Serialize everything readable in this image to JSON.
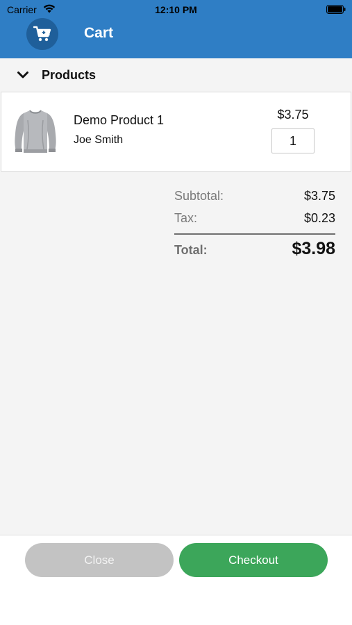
{
  "status_bar": {
    "carrier": "Carrier",
    "time": "12:10 PM",
    "icons": [
      "wifi-icon",
      "battery-icon"
    ]
  },
  "nav": {
    "title": "Cart",
    "icon": "cart-icon",
    "color": "#2f7ec5"
  },
  "products_section": {
    "title": "Products",
    "icon": "chevron-down-icon",
    "items": [
      {
        "name": "Demo Product 1",
        "owner": "Joe Smith",
        "price": "$3.75",
        "quantity": "1",
        "image": "sweatshirt-image"
      }
    ]
  },
  "totals": {
    "subtotal_label": "Subtotal:",
    "subtotal_value": "$3.75",
    "tax_label": "Tax:",
    "tax_value": "$0.23",
    "total_label": "Total:",
    "total_value": "$3.98"
  },
  "footer": {
    "close_label": "Close",
    "checkout_label": "Checkout",
    "close_color": "#c3c3c3",
    "checkout_color": "#3ca65a"
  }
}
